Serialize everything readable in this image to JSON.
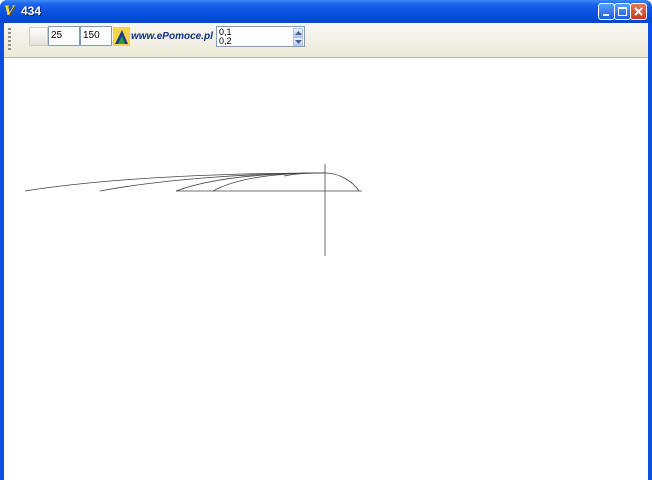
{
  "window": {
    "title": "434",
    "app_icon": "app-logo-icon",
    "controls": {
      "minimize": "minimize-icon",
      "maximize": "maximize-icon",
      "close": "close-icon"
    }
  },
  "toolbar": {
    "field_a": "25",
    "field_b": "150",
    "logo_text": "www.ePomoce.pl",
    "list_items": [
      "0,1",
      "0,2"
    ],
    "list_up_icon": "arrow-up-icon",
    "list_down_icon": "arrow-down-icon"
  },
  "colors": {
    "titlebar": "#0a52e0",
    "toolbar": "#ece9d8",
    "canvas": "#ffffff",
    "curve_stroke": "#444444"
  }
}
